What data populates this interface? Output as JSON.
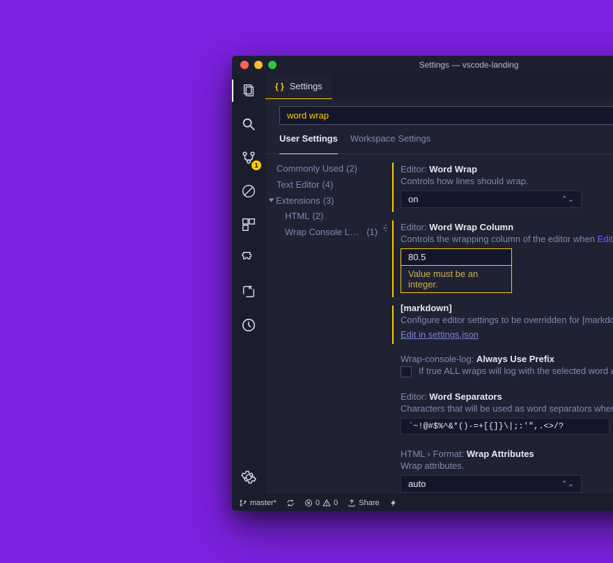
{
  "window": {
    "title": "Settings — vscode-landing"
  },
  "activitybar": {
    "scm_badge": "1"
  },
  "tabs": {
    "settings_label": "Settings"
  },
  "search": {
    "value": "word wrap"
  },
  "scopes": {
    "user": "User Settings",
    "workspace": "Workspace Settings"
  },
  "toc": {
    "items": [
      {
        "label": "Commonly Used",
        "count": "(2)",
        "level": 0
      },
      {
        "label": "Text Editor",
        "count": "(4)",
        "level": 0
      },
      {
        "label": "Extensions",
        "count": "(3)",
        "level": 0,
        "expanded": true
      },
      {
        "label": "HTML",
        "count": "(2)",
        "level": 1
      },
      {
        "label": "Wrap Console L…",
        "count": "(1)",
        "level": 1
      }
    ]
  },
  "settings": {
    "wordWrap": {
      "prefix": "Editor:",
      "name": "Word Wrap",
      "desc": "Controls how lines should wrap.",
      "value": "on"
    },
    "wordWrapColumn": {
      "prefix": "Editor:",
      "name": "Word Wrap Column",
      "desc_pre": "Controls the wrapping column of the editor when ",
      "desc_hl": "Editor: Wor",
      "value": "80.5",
      "validation": "Value must be an integer."
    },
    "markdown": {
      "name": "[markdown]",
      "desc": "Configure editor settings to be overridden for [markdown] la",
      "action": "Edit in settings.json"
    },
    "wrapConsoleLog": {
      "prefix": "Wrap-console-log:",
      "name": "Always Use Prefix",
      "desc": "If true ALL wraps will log with the selected word as prefi"
    },
    "wordSeparators": {
      "prefix": "Editor:",
      "name": "Word Separators",
      "desc": "Characters that will be used as word separators when doing",
      "value": "`~!@#$%^&*()-=+[{]}\\|;:'\",.<>/?"
    },
    "wrapAttributes": {
      "prefix": "HTML › Format:",
      "name": "Wrap Attributes",
      "desc": "Wrap attributes.",
      "value": "auto"
    }
  },
  "statusbar": {
    "branch": "master*",
    "errors": "0",
    "warnings": "0",
    "share": "Share"
  }
}
